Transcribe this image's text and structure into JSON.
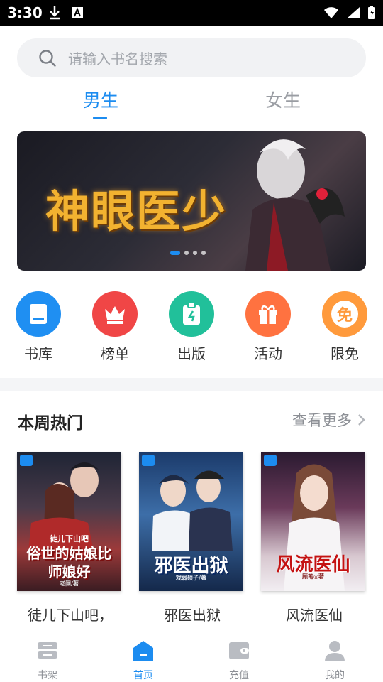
{
  "status_bar": {
    "time": "3:30"
  },
  "search": {
    "placeholder": "请输入书名搜索"
  },
  "gender_tabs": [
    {
      "label": "男生",
      "active": true
    },
    {
      "label": "女生",
      "active": false
    }
  ],
  "banner": {
    "title": "神眼医少",
    "dots": 4,
    "active_dot": 0
  },
  "quick_nav": [
    {
      "label": "书库",
      "icon": "book-icon",
      "color": "#1f8ff2"
    },
    {
      "label": "榜单",
      "icon": "crown-icon",
      "color": "#f04646"
    },
    {
      "label": "出版",
      "icon": "clipboard-icon",
      "color": "#21c09a"
    },
    {
      "label": "活动",
      "icon": "gift-icon",
      "color": "#ff7240"
    },
    {
      "label": "限免",
      "icon": "free-icon",
      "color": "#ff9a3c",
      "glyph": "免"
    }
  ],
  "weekly_hot": {
    "title": "本周热门",
    "more_label": "查看更多",
    "books": [
      {
        "title": "徒儿下山吧，",
        "cover_text": "俗世的姑娘比师娘好",
        "cover_small": "徒儿下山吧",
        "author": "老闸/著"
      },
      {
        "title": "邪医出狱",
        "cover_text": "邪医出狱",
        "author": "戏弱硕子/著"
      },
      {
        "title": "风流医仙",
        "cover_text": "风流医仙",
        "author": "顾笔◎著"
      }
    ]
  },
  "bottom_nav": [
    {
      "label": "书架",
      "icon": "bookshelf-icon",
      "active": false
    },
    {
      "label": "首页",
      "icon": "home-icon",
      "active": true
    },
    {
      "label": "充值",
      "icon": "wallet-icon",
      "active": false
    },
    {
      "label": "我的",
      "icon": "user-icon",
      "active": false
    }
  ],
  "colors": {
    "accent": "#1c8cf0"
  }
}
